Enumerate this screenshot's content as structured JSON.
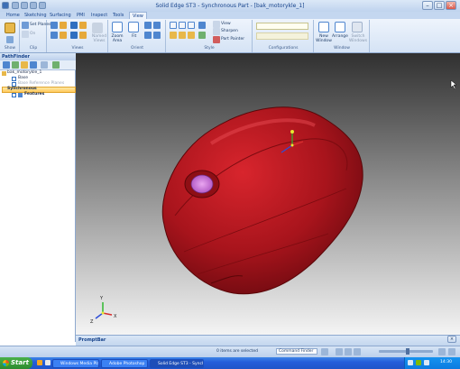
{
  "window": {
    "title": "Solid Edge ST3 - Synchronous Part - [bak_motorykle_1]"
  },
  "tabs": [
    {
      "label": "Home"
    },
    {
      "label": "Sketching"
    },
    {
      "label": "Surfacing"
    },
    {
      "label": "PMI"
    },
    {
      "label": "Inspect"
    },
    {
      "label": "Tools"
    },
    {
      "label": "View"
    }
  ],
  "ribbon": {
    "groups": [
      {
        "label": "Show"
      },
      {
        "label": "Clip"
      },
      {
        "label": "Views"
      },
      {
        "label": "Orient"
      },
      {
        "label": "Style"
      },
      {
        "label": "Configurations"
      },
      {
        "label": "Window"
      }
    ],
    "set_planes": "Set Planes",
    "on": "On",
    "named_views": "Named Views",
    "zoom_area": "Zoom Area",
    "fit": "Fit",
    "view_label": "View",
    "sharpen": "Sharpen",
    "part_painter": "Part Painter",
    "new_window": "New Window",
    "arrange": "Arrange",
    "switch_windows": "Switch Windows"
  },
  "pathfinder": {
    "title": "PathFinder",
    "items": [
      {
        "label": "bak_motorykle_1"
      },
      {
        "label": "Base"
      },
      {
        "label": "Base Reference Planes"
      },
      {
        "label": "Synchronous"
      },
      {
        "label": "Features"
      }
    ]
  },
  "promptbar": {
    "title": "PromptBar"
  },
  "status": {
    "selection": "0 items are selected",
    "command_finder": "Command Finder"
  },
  "taskbar": {
    "start": "Start",
    "tasks": [
      {
        "label": "Windows Media Player"
      },
      {
        "label": "Adobe Photoshop"
      },
      {
        "label": "Solid Edge ST3 - Synchr..."
      }
    ],
    "clock": "14:30"
  },
  "colors": {
    "part": "#a8141c",
    "hole_face": "#d77be0",
    "accent": "#15428b"
  },
  "icons": [
    "search-icon",
    "gear-icon",
    "zoom-icon",
    "fit-icon",
    "window-icon"
  ]
}
